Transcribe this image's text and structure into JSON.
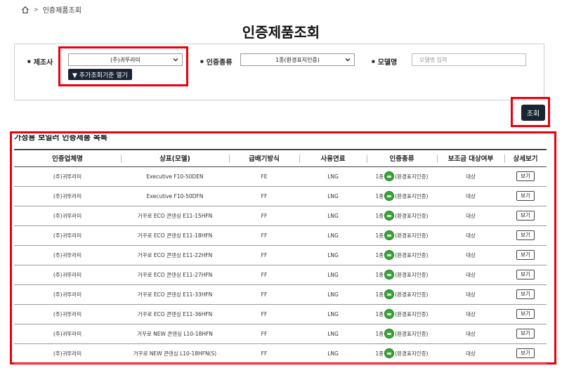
{
  "breadcrumb": {
    "home_icon": "home-icon",
    "current": "인증제품조회"
  },
  "page_title": "인증제품조회",
  "search": {
    "manufacturer_label": "제조사",
    "manufacturer_value": "(주)귀뚜라미",
    "more_button": "▼ 추가조회기준 열기",
    "cert_type_label": "인증종류",
    "cert_type_value": "1종(환경표지인증)",
    "model_label": "모델명",
    "model_placeholder": "모델명 입력",
    "search_button": "조회"
  },
  "list_title": "가정용 보일러 인증제품 목록",
  "table": {
    "headers": [
      "인증업체명",
      "상표(모델)",
      "급배기방식",
      "사용연료",
      "인증종류",
      "보조금 대상여부",
      "상세보기"
    ],
    "rows": [
      {
        "company": "(주)귀뚜라미",
        "model": "Executive F10-50DEN",
        "exhaust": "FE",
        "fuel": "LNG",
        "cert_pre": "1종",
        "cert_post": "(환경표지인증)",
        "subsidy": "대상",
        "detail": "보기"
      },
      {
        "company": "(주)귀뚜라미",
        "model": "Executive F10-50DFN",
        "exhaust": "FF",
        "fuel": "LNG",
        "cert_pre": "1종",
        "cert_post": "(환경표지인증)",
        "subsidy": "대상",
        "detail": "보기"
      },
      {
        "company": "(주)귀뚜라미",
        "model": "거꾸로 ECO 콘덴싱 E11-15HFN",
        "exhaust": "FF",
        "fuel": "LNG",
        "cert_pre": "1종",
        "cert_post": "(환경표지인증)",
        "subsidy": "대상",
        "detail": "보기"
      },
      {
        "company": "(주)귀뚜라미",
        "model": "거꾸로 ECO 콘덴싱 E11-18HFN",
        "exhaust": "FF",
        "fuel": "LNG",
        "cert_pre": "1종",
        "cert_post": "(환경표지인증)",
        "subsidy": "대상",
        "detail": "보기"
      },
      {
        "company": "(주)귀뚜라미",
        "model": "거꾸로 ECO 콘덴싱 E11-22HFN",
        "exhaust": "FF",
        "fuel": "LNG",
        "cert_pre": "1종",
        "cert_post": "(환경표지인증)",
        "subsidy": "대상",
        "detail": "보기"
      },
      {
        "company": "(주)귀뚜라미",
        "model": "거꾸로 ECO 콘덴싱 E11-27HFN",
        "exhaust": "FF",
        "fuel": "LNG",
        "cert_pre": "1종",
        "cert_post": "(환경표지인증)",
        "subsidy": "대상",
        "detail": "보기"
      },
      {
        "company": "(주)귀뚜라미",
        "model": "거꾸로 ECO 콘덴싱 E11-33HFN",
        "exhaust": "FF",
        "fuel": "LNG",
        "cert_pre": "1종",
        "cert_post": "(환경표지인증)",
        "subsidy": "대상",
        "detail": "보기"
      },
      {
        "company": "(주)귀뚜라미",
        "model": "거꾸로 ECO 콘덴싱 E11-36HFN",
        "exhaust": "FF",
        "fuel": "LNG",
        "cert_pre": "1종",
        "cert_post": "(환경표지인증)",
        "subsidy": "대상",
        "detail": "보기"
      },
      {
        "company": "(주)귀뚜라미",
        "model": "거꾸로 NEW 콘덴싱 L10-18HFN",
        "exhaust": "FF",
        "fuel": "LNG",
        "cert_pre": "1종",
        "cert_post": "(환경표지인증)",
        "subsidy": "대상",
        "detail": "보기"
      },
      {
        "company": "(주)귀뚜라미",
        "model": "거꾸로 NEW 콘덴싱 L10-18HFN(S)",
        "exhaust": "FF",
        "fuel": "LNG",
        "cert_pre": "1종",
        "cert_post": "(환경표지인증)",
        "subsidy": "대상",
        "detail": "보기"
      }
    ]
  },
  "colors": {
    "highlight_border": "#e8000d",
    "button_bg": "#1b2433",
    "eco_badge": "#3aa53a"
  }
}
